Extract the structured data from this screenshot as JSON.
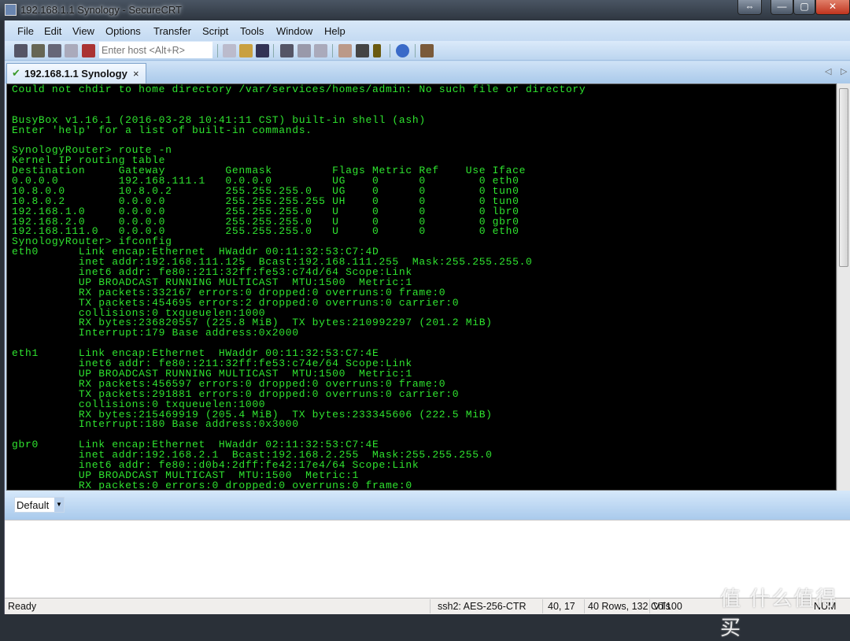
{
  "window": {
    "title": "192.168.1.1 Synology - SecureCRT",
    "buttons": [
      "⇔",
      "—",
      "▢",
      "✕"
    ]
  },
  "menu": [
    "File",
    "Edit",
    "View",
    "Options",
    "Transfer",
    "Script",
    "Tools",
    "Window",
    "Help"
  ],
  "toolbar": {
    "host_placeholder": "Enter host <Alt+R>",
    "icons": [
      "connect-icon",
      "quick-connect-icon",
      "connect-tab-icon",
      "reconnect-icon",
      "disconnect-icon",
      "copy-icon",
      "paste-icon",
      "find-icon",
      "print-screen-icon",
      "print-selection-icon",
      "print-icon",
      "session-options-icon",
      "global-options-icon",
      "keymap-icon",
      "help-icon",
      "sftp-icon"
    ]
  },
  "tab": {
    "label": "192.168.1.1 Synology",
    "close": "×",
    "status_icon": "connected-check-icon",
    "nav_prev": "◁",
    "nav_next": "▷"
  },
  "terminal": {
    "color": "#2fe42f",
    "background": "#000000",
    "lines": [
      "Could not chdir to home directory /var/services/homes/admin: No such file or directory",
      "",
      "",
      "BusyBox v1.16.1 (2016-03-28 10:41:11 CST) built-in shell (ash)",
      "Enter 'help' for a list of built-in commands.",
      "",
      "SynologyRouter> route -n",
      "Kernel IP routing table",
      "Destination     Gateway         Genmask         Flags Metric Ref    Use Iface",
      "0.0.0.0         192.168.111.1   0.0.0.0         UG    0      0        0 eth0",
      "10.8.0.0        10.8.0.2        255.255.255.0   UG    0      0        0 tun0",
      "10.8.0.2        0.0.0.0         255.255.255.255 UH    0      0        0 tun0",
      "192.168.1.0     0.0.0.0         255.255.255.0   U     0      0        0 lbr0",
      "192.168.2.0     0.0.0.0         255.255.255.0   U     0      0        0 gbr0",
      "192.168.111.0   0.0.0.0         255.255.255.0   U     0      0        0 eth0",
      "SynologyRouter> ifconfig",
      "eth0      Link encap:Ethernet  HWaddr 00:11:32:53:C7:4D",
      "          inet addr:192.168.111.125  Bcast:192.168.111.255  Mask:255.255.255.0",
      "          inet6 addr: fe80::211:32ff:fe53:c74d/64 Scope:Link",
      "          UP BROADCAST RUNNING MULTICAST  MTU:1500  Metric:1",
      "          RX packets:332167 errors:0 dropped:0 overruns:0 frame:0",
      "          TX packets:454695 errors:2 dropped:0 overruns:0 carrier:0",
      "          collisions:0 txqueuelen:1000",
      "          RX bytes:236820557 (225.8 MiB)  TX bytes:210992297 (201.2 MiB)",
      "          Interrupt:179 Base address:0x2000",
      "",
      "eth1      Link encap:Ethernet  HWaddr 00:11:32:53:C7:4E",
      "          inet6 addr: fe80::211:32ff:fe53:c74e/64 Scope:Link",
      "          UP BROADCAST RUNNING MULTICAST  MTU:1500  Metric:1",
      "          RX packets:456597 errors:0 dropped:0 overruns:0 frame:0",
      "          TX packets:291881 errors:0 dropped:0 overruns:0 carrier:0",
      "          collisions:0 txqueuelen:1000",
      "          RX bytes:215469919 (205.4 MiB)  TX bytes:233345606 (222.5 MiB)",
      "          Interrupt:180 Base address:0x3000",
      "",
      "gbr0      Link encap:Ethernet  HWaddr 02:11:32:53:C7:4E",
      "          inet addr:192.168.2.1  Bcast:192.168.2.255  Mask:255.255.255.0",
      "          inet6 addr: fe80::d0b4:2dff:fe42:17e4/64 Scope:Link",
      "          UP BROADCAST MULTICAST  MTU:1500  Metric:1",
      "          RX packets:0 errors:0 dropped:0 overruns:0 frame:0"
    ]
  },
  "session_combo": {
    "value": "Default"
  },
  "status": {
    "ready": "Ready",
    "cipher": "ssh2: AES-256-CTR",
    "cursor": "40,  17",
    "size": "40 Rows, 132 Cols",
    "emulation": "VT100",
    "num": "NUM"
  },
  "watermark": "值 什么值得买"
}
